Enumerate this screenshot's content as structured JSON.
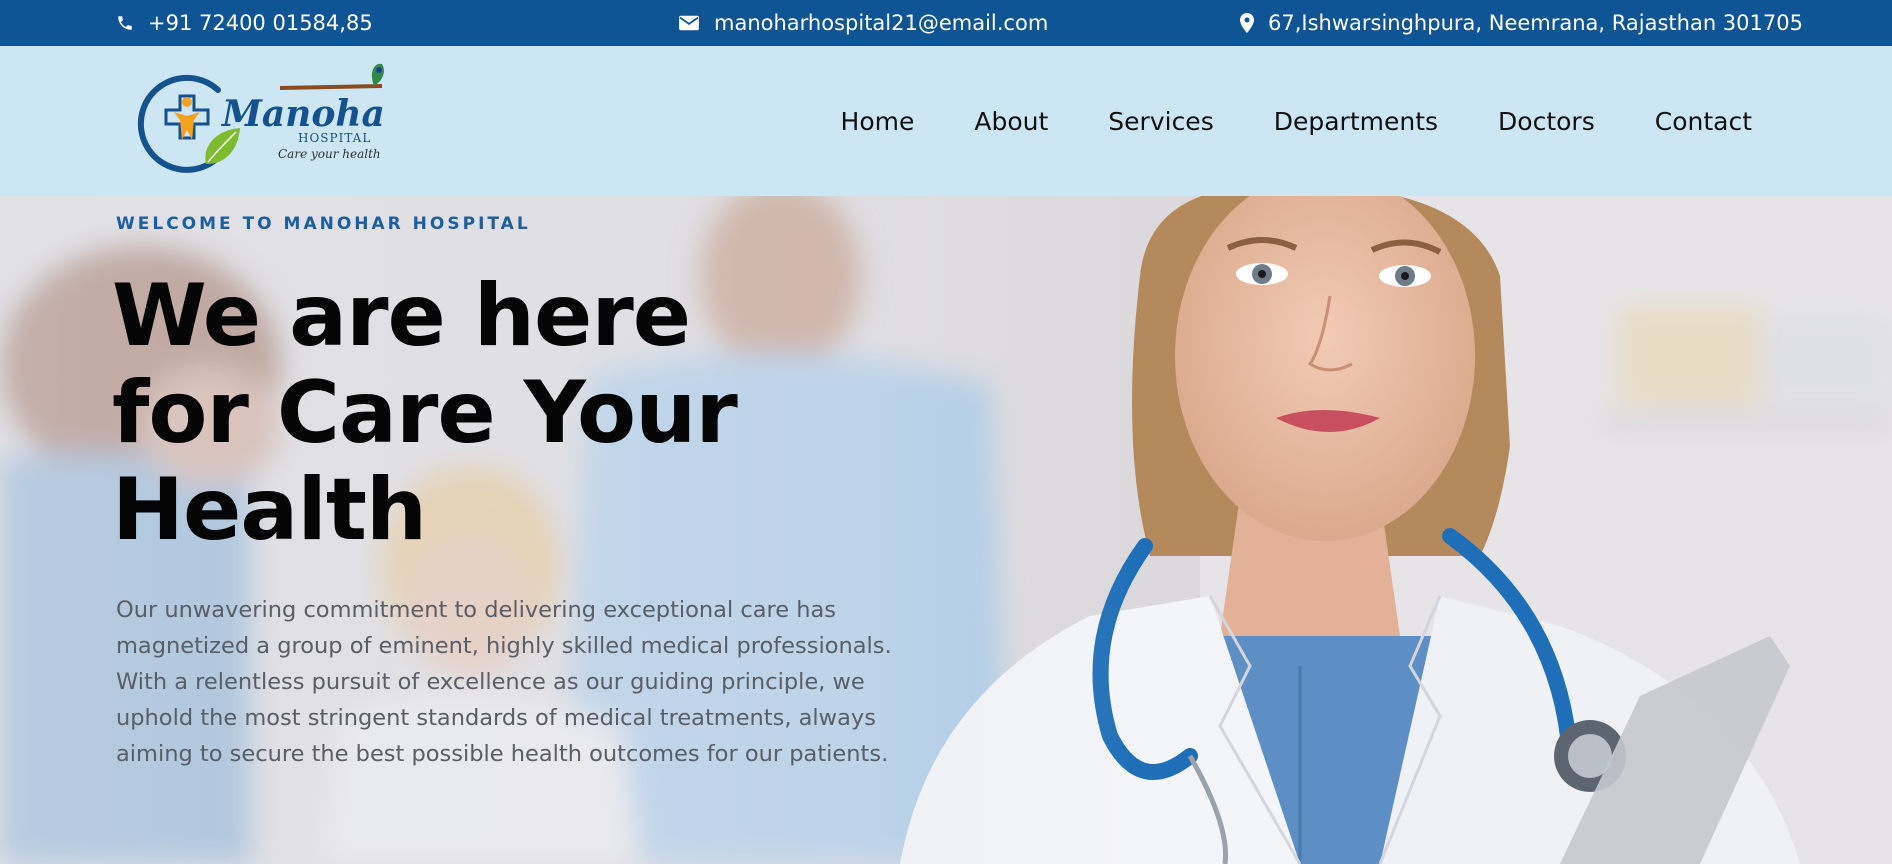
{
  "topbar": {
    "phone": "+91 72400 01584,85",
    "email": "manoharhospital21@email.com",
    "address": "67,Ishwarsinghpura, Neemrana, Rajasthan 301705",
    "phone_icon": "phone-icon",
    "email_icon": "envelope-icon",
    "address_icon": "map-marker-icon"
  },
  "logo": {
    "name": "Manohar",
    "sub": "HOSPITAL",
    "tagline": "Care your health"
  },
  "nav": {
    "items": [
      "Home",
      "About",
      "Services",
      "Departments",
      "Doctors",
      "Contact"
    ]
  },
  "hero": {
    "eyebrow": "WELCOME TO MANOHAR HOSPITAL",
    "headline_lines": [
      "We are here",
      "for Care Your",
      "Health"
    ],
    "description": "Our unwavering commitment to delivering exceptional care has magnetized a group of eminent, highly skilled medical professionals. With a relentless pursuit of excellence as our guiding principle, we uphold the most stringent standards of medical treatments, always aiming to secure the best possible health outcomes for our patients."
  },
  "colors": {
    "topbar_bg": "#0f5596",
    "header_bg": "#cce6f4",
    "accent_blue": "#1d5ea3",
    "logo_orange": "#f5a21b",
    "logo_green": "#7cbc2e"
  }
}
